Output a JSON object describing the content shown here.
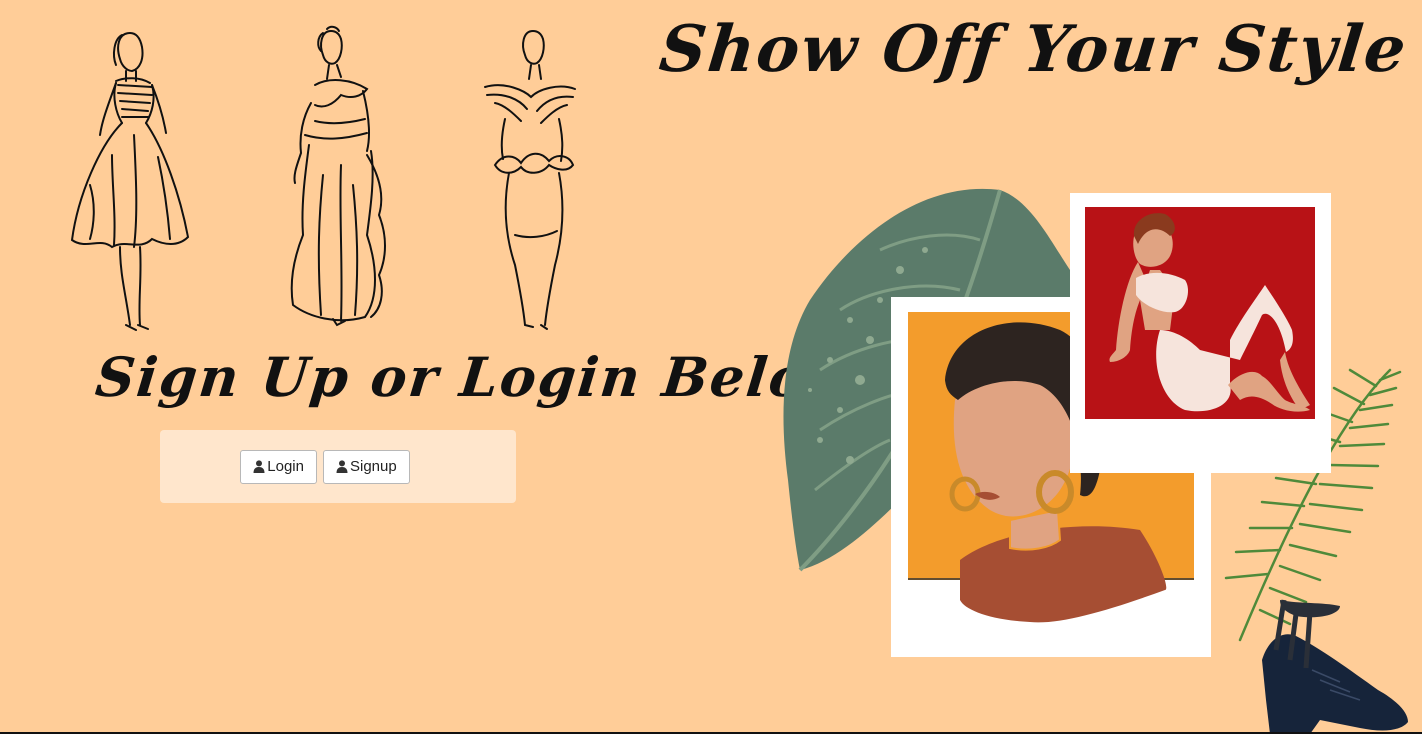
{
  "page": {
    "headline": "Show Off Your Style",
    "subheadline": "Sign Up or Login Below"
  },
  "auth": {
    "login_label": "Login",
    "signup_label": "Signup",
    "user_icon": "user-icon"
  },
  "colors": {
    "background": "#ffcd98",
    "panel": "#ffe6cc",
    "ink": "#111111",
    "leaf": "#5a7a6a",
    "photo_orange": "#f39c2c",
    "photo_red": "#b81216",
    "shirt": "#a64e33",
    "skin": "#e0a382",
    "shoe": "#16243a"
  },
  "illustrations": [
    "fashion-sketch-dress-icon",
    "fashion-sketch-gown-icon",
    "fashion-sketch-peplum-icon",
    "monstera-leaf-icon",
    "palm-frond-icon",
    "polaroid-portrait-icon",
    "polaroid-seated-woman-icon",
    "high-heel-shoe-icon"
  ]
}
